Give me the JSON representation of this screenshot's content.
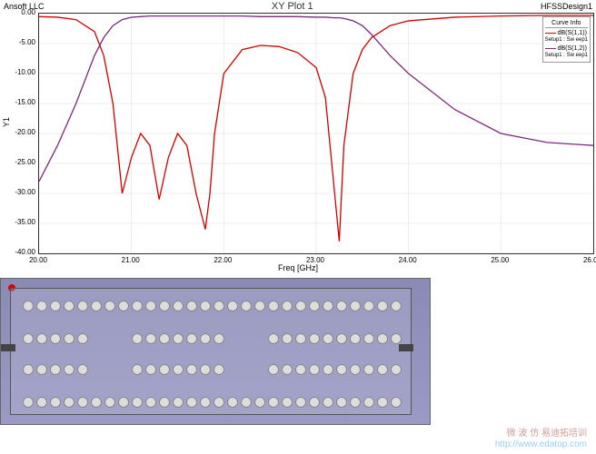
{
  "header": {
    "left": "Ansoft LLC",
    "title": "XY Plot 1",
    "right": "HFSSDesign1"
  },
  "axes": {
    "ylabel": "Y1",
    "xlabel": "Freq [GHz]",
    "xticks": [
      "20.00",
      "21.00",
      "22.00",
      "23.00",
      "24.00",
      "25.00",
      "26.00"
    ],
    "yticks": [
      "0.00",
      "-5.00",
      "-10.00",
      "-15.00",
      "-20.00",
      "-25.00",
      "-30.00",
      "-35.00",
      "-40.00"
    ]
  },
  "legend": {
    "title": "Curve Info",
    "items": [
      {
        "label": "dB(S(1,1))",
        "sub": "Setup1 : Sw eep1",
        "color": "#d00000"
      },
      {
        "label": "dB(S(1,2))",
        "sub": "Setup1 : Sw eep1",
        "color": "#7a2a7a"
      }
    ]
  },
  "watermark": {
    "line1": "微 波 仿 易迪拓培训",
    "line2": "http://www.edatop.com"
  },
  "chart_data": {
    "type": "line",
    "title": "XY Plot 1",
    "xlabel": "Freq [GHz]",
    "ylabel": "Y1",
    "xlim": [
      20.0,
      26.0
    ],
    "ylim": [
      -40.0,
      0.0
    ],
    "x": [
      20.0,
      20.2,
      20.4,
      20.6,
      20.7,
      20.8,
      20.9,
      21.0,
      21.1,
      21.2,
      21.3,
      21.4,
      21.5,
      21.6,
      21.7,
      21.8,
      21.85,
      21.9,
      22.0,
      22.2,
      22.4,
      22.6,
      22.8,
      23.0,
      23.1,
      23.2,
      23.25,
      23.3,
      23.4,
      23.5,
      23.6,
      23.8,
      24.0,
      24.5,
      25.0,
      25.5,
      26.0
    ],
    "series": [
      {
        "name": "dB(S(1,1))",
        "color": "#d00000",
        "values": [
          -0.5,
          -0.6,
          -1.0,
          -3.0,
          -7.0,
          -15.0,
          -30.0,
          -24.0,
          -20.0,
          -22.0,
          -31.0,
          -24.0,
          -20.0,
          -22.0,
          -30.0,
          -36.0,
          -30.0,
          -20.0,
          -10.0,
          -6.0,
          -5.3,
          -5.5,
          -6.5,
          -9.0,
          -14.0,
          -30.0,
          -38.0,
          -22.0,
          -10.0,
          -6.0,
          -4.0,
          -2.0,
          -1.2,
          -0.6,
          -0.4,
          -0.3,
          -0.3
        ]
      },
      {
        "name": "dB(S(1,2))",
        "color": "#7a2a7a",
        "values": [
          -28.0,
          -22.0,
          -15.0,
          -7.0,
          -4.0,
          -2.0,
          -1.0,
          -0.6,
          -0.5,
          -0.4,
          -0.4,
          -0.4,
          -0.4,
          -0.4,
          -0.4,
          -0.4,
          -0.4,
          -0.4,
          -0.4,
          -0.4,
          -0.5,
          -0.5,
          -0.5,
          -0.6,
          -0.6,
          -0.7,
          -0.7,
          -0.8,
          -1.2,
          -2.0,
          -3.5,
          -7.0,
          -10.0,
          -16.0,
          -20.0,
          -21.5,
          -22.0
        ]
      }
    ]
  }
}
